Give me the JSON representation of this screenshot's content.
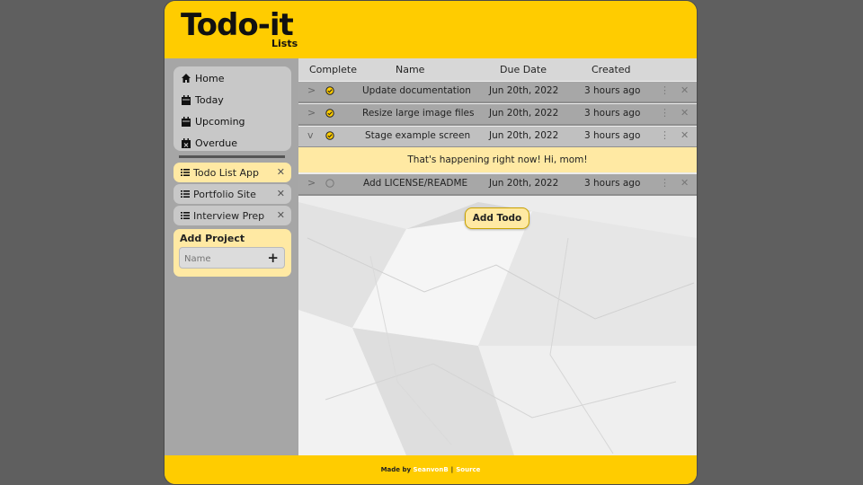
{
  "header": {
    "title": "Todo-it",
    "subtitle": "Lists"
  },
  "sidebar": {
    "nav": [
      {
        "label": "Home",
        "icon": "home-icon"
      },
      {
        "label": "Today",
        "icon": "calendar-icon"
      },
      {
        "label": "Upcoming",
        "icon": "calendar-icon"
      },
      {
        "label": "Overdue",
        "icon": "calendar-x-icon"
      }
    ],
    "projects": [
      {
        "label": "Todo List App",
        "active": true
      },
      {
        "label": "Portfolio Site",
        "active": false
      },
      {
        "label": "Interview Prep",
        "active": false
      }
    ],
    "add_project": {
      "label": "Add Project",
      "placeholder": "Name",
      "add_symbol": "+"
    }
  },
  "table": {
    "headers": {
      "complete": "Complete",
      "name": "Name",
      "due": "Due Date",
      "created": "Created"
    },
    "rows": [
      {
        "name": "Update documentation",
        "due": "Jun 20th, 2022",
        "created": "3 hours ago",
        "complete": true,
        "expanded": false
      },
      {
        "name": "Resize large image files",
        "due": "Jun 20th, 2022",
        "created": "3 hours ago",
        "complete": true,
        "expanded": false
      },
      {
        "name": "Stage example screen",
        "due": "Jun 20th, 2022",
        "created": "3 hours ago",
        "complete": true,
        "expanded": true
      },
      {
        "name": "Add LICENSE/README",
        "due": "Jun 20th, 2022",
        "created": "3 hours ago",
        "complete": false,
        "expanded": false
      }
    ],
    "detail_text": "That's happening right now! Hi, mom!"
  },
  "add_todo_label": "Add Todo",
  "footer": {
    "made_by": "Made by",
    "author": "SeanvonB",
    "separator": "|",
    "source": "Source"
  },
  "colors": {
    "accent": "#ffcc00",
    "highlight": "#ffe9a3",
    "row": "#a7a7a7"
  }
}
